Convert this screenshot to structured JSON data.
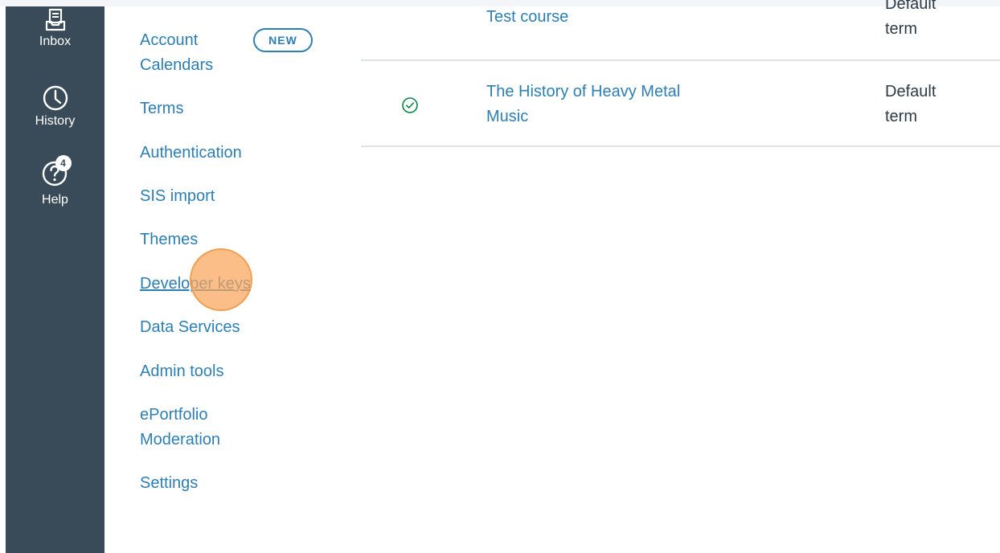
{
  "global_nav": {
    "inbox": {
      "label": "Inbox",
      "icon": "inbox-icon"
    },
    "history": {
      "label": "History",
      "icon": "clock-icon"
    },
    "help": {
      "label": "Help",
      "icon": "help-icon",
      "badge": "4"
    }
  },
  "account_nav": {
    "items": [
      {
        "label": "Account",
        "label2": "Calendars",
        "badge": "NEW"
      },
      {
        "label": "Terms"
      },
      {
        "label": "Authentication"
      },
      {
        "label": "SIS import"
      },
      {
        "label": "Themes"
      },
      {
        "label": "Developer keys"
      },
      {
        "label": "Data Services"
      },
      {
        "label": "Admin tools"
      },
      {
        "label": "ePortfolio",
        "label2": "Moderation"
      },
      {
        "label": "Settings"
      }
    ]
  },
  "courses": [
    {
      "name": "Test course",
      "term_line1": "Default",
      "term_line2": "term"
    },
    {
      "name_line1": "The History of Heavy Metal",
      "name_line2": "Music",
      "term_line1": "Default",
      "term_line2": "term",
      "status_icon": "published-check-icon"
    }
  ],
  "colors": {
    "nav_bg": "#394b58",
    "link": "#2d7fb3",
    "text": "#2d3b45",
    "published": "#0b874b",
    "click_indicator": "#faa55a"
  }
}
